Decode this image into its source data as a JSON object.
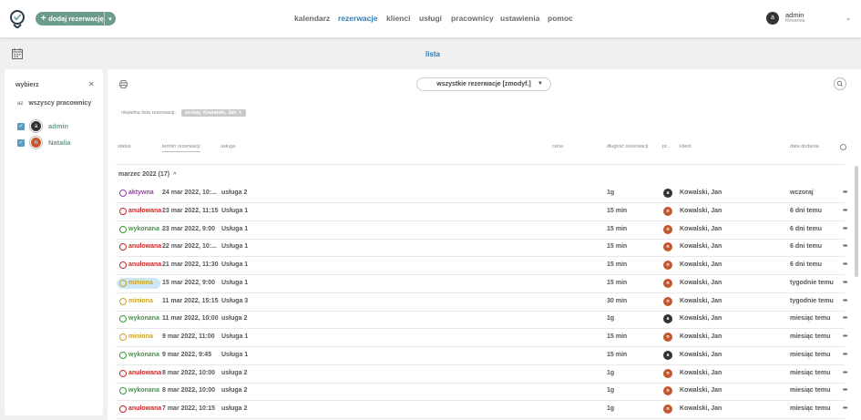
{
  "header": {
    "add_button_label": "dodaj rezerwację",
    "nav": [
      {
        "label": "kalendarz",
        "active": false
      },
      {
        "label": "rezerwacje",
        "active": true
      },
      {
        "label": "klienci",
        "active": false
      },
      {
        "label": "usługi",
        "active": false
      },
      {
        "label": "pracownicy",
        "active": false
      },
      {
        "label": "ustawienia",
        "active": false
      },
      {
        "label": "pomoc",
        "active": false
      }
    ],
    "user": {
      "initial": "a",
      "name": "admin",
      "company": "Reservis"
    }
  },
  "view_title": "lista",
  "sidebar": {
    "title": "wybierz",
    "all_label": "wszyscy pracownicy",
    "sort_icon_label": "az",
    "employees": [
      {
        "name": "admin",
        "initial": "a",
        "color": "#333333",
        "checked": true
      },
      {
        "name": "Natalia",
        "initial": "n",
        "color": "#c4572e",
        "checked": true
      }
    ]
  },
  "main": {
    "filter_select": "wszystkie rezerwacje [zmodyf.]",
    "incomplete_label": "niepełna lista rezerwacji:",
    "chip_label": "szukaj: Kowalski, Jan",
    "columns": {
      "status": "status",
      "termin": "termin rezerwacji",
      "usluga": "usługa",
      "cena": "cena",
      "dlugosc": "długość rezerwacji",
      "pr": "pr...",
      "klient": "klient",
      "data_dodania": "data dodania"
    },
    "group_label": "marzec 2022 (17)",
    "rows": [
      {
        "status": "aktywna",
        "status_type": "active",
        "date": "24 mar 2022, 10:...",
        "service": "usługa 2",
        "duration": "1g",
        "avatar_initial": "a",
        "avatar_color": "#333333",
        "client": "Kowalski, Jan",
        "added": "wczoraj"
      },
      {
        "status": "anulowana",
        "status_type": "cancelled",
        "date": "23 mar 2022, 11:15",
        "service": "Usługa 1",
        "duration": "15 min",
        "avatar_initial": "n",
        "avatar_color": "#c4572e",
        "client": "Kowalski, Jan",
        "added": "6 dni temu"
      },
      {
        "status": "wykonana",
        "status_type": "done",
        "date": "23 mar 2022, 9:00",
        "service": "Usługa 1",
        "duration": "15 min",
        "avatar_initial": "n",
        "avatar_color": "#c4572e",
        "client": "Kowalski, Jan",
        "added": "6 dni temu"
      },
      {
        "status": "anulowana",
        "status_type": "cancelled",
        "date": "22 mar 2022, 10:...",
        "service": "Usługa 1",
        "duration": "15 min",
        "avatar_initial": "n",
        "avatar_color": "#c4572e",
        "client": "Kowalski, Jan",
        "added": "6 dni temu"
      },
      {
        "status": "anulowana",
        "status_type": "cancelled",
        "date": "21 mar 2022, 11:30",
        "service": "Usługa 1",
        "duration": "15 min",
        "avatar_initial": "n",
        "avatar_color": "#c4572e",
        "client": "Kowalski, Jan",
        "added": "6 dni temu"
      },
      {
        "status": "miniona",
        "status_type": "past",
        "highlight": true,
        "date": "15 mar 2022, 9:00",
        "service": "Usługa 1",
        "duration": "15 min",
        "avatar_initial": "n",
        "avatar_color": "#c4572e",
        "client": "Kowalski, Jan",
        "added": "tygodnie temu"
      },
      {
        "status": "miniona",
        "status_type": "past",
        "date": "11 mar 2022, 15:15",
        "service": "Usługa 3",
        "duration": "30 min",
        "avatar_initial": "n",
        "avatar_color": "#c4572e",
        "client": "Kowalski, Jan",
        "added": "tygodnie temu"
      },
      {
        "status": "wykonana",
        "status_type": "done",
        "date": "11 mar 2022, 10:00",
        "service": "usługa 2",
        "duration": "1g",
        "avatar_initial": "a",
        "avatar_color": "#333333",
        "client": "Kowalski, Jan",
        "added": "miesiąc temu"
      },
      {
        "status": "miniona",
        "status_type": "past",
        "date": "9 mar 2022, 11:00",
        "service": "Usługa 1",
        "duration": "15 min",
        "avatar_initial": "n",
        "avatar_color": "#c4572e",
        "client": "Kowalski, Jan",
        "added": "miesiąc temu"
      },
      {
        "status": "wykonana",
        "status_type": "done",
        "date": "9 mar 2022, 9:45",
        "service": "Usługa 1",
        "duration": "15 min",
        "avatar_initial": "a",
        "avatar_color": "#333333",
        "client": "Kowalski, Jan",
        "added": "miesiąc temu"
      },
      {
        "status": "anulowana",
        "status_type": "cancelled",
        "date": "8 mar 2022, 10:00",
        "service": "usługa 2",
        "duration": "1g",
        "avatar_initial": "n",
        "avatar_color": "#c4572e",
        "client": "Kowalski, Jan",
        "added": "miesiąc temu"
      },
      {
        "status": "wykonana",
        "status_type": "done",
        "date": "8 mar 2022, 10:00",
        "service": "usługa 2",
        "duration": "1g",
        "avatar_initial": "n",
        "avatar_color": "#c4572e",
        "client": "Kowalski, Jan",
        "added": "miesiąc temu"
      },
      {
        "status": "anulowana",
        "status_type": "cancelled",
        "date": "7 mar 2022, 10:15",
        "service": "usługa 2",
        "duration": "1g",
        "avatar_initial": "n",
        "avatar_color": "#c4572e",
        "client": "Kowalski, Jan",
        "added": "miesiąc temu"
      }
    ]
  },
  "status_colors": {
    "active": "#9b3fae",
    "cancelled": "#c62828",
    "done": "#3b9a3b",
    "past": "#c9a227"
  }
}
